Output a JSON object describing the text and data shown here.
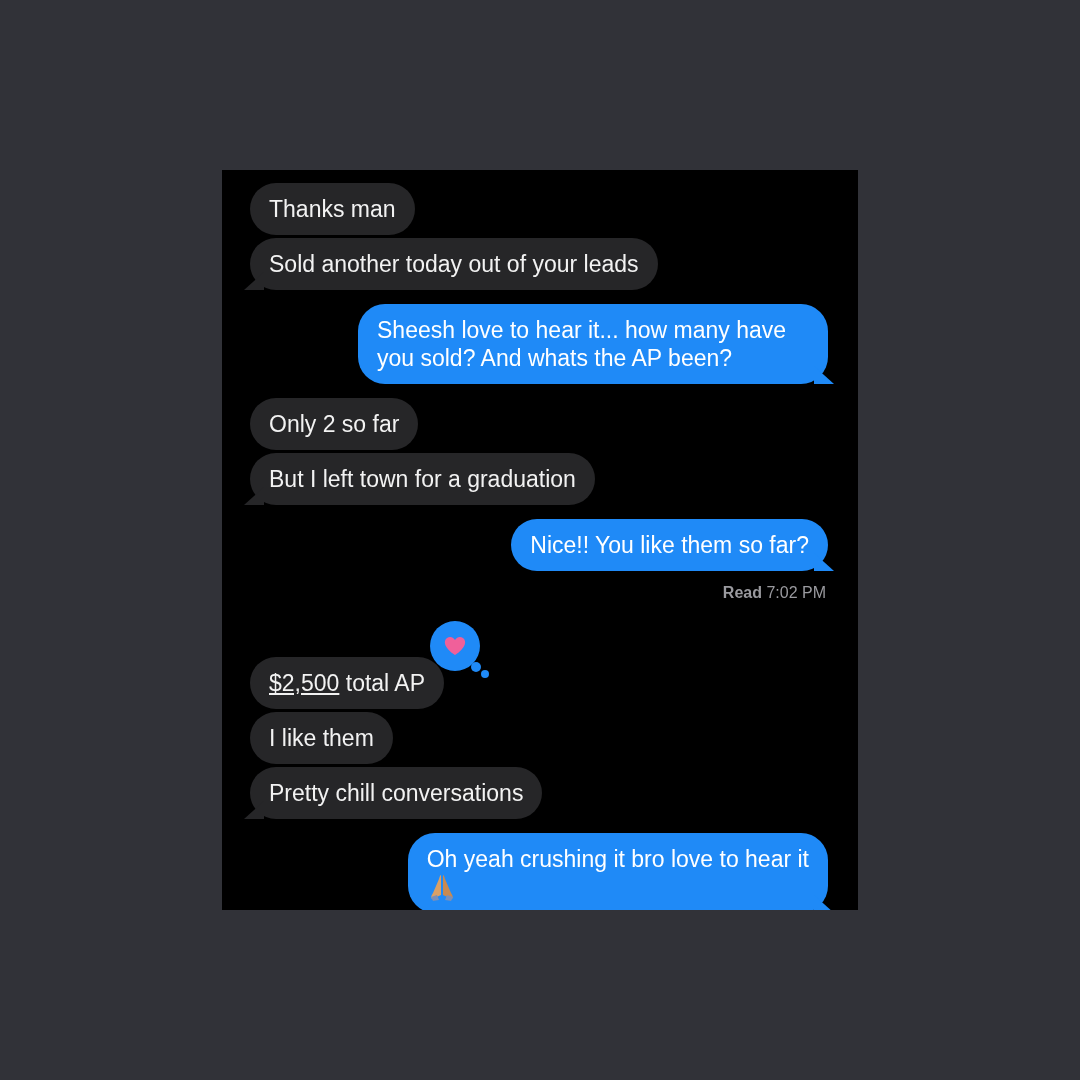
{
  "messages": [
    {
      "kind": "incoming",
      "tail": false,
      "parts": [
        {
          "text": "Thanks man",
          "link": false
        }
      ]
    },
    {
      "kind": "incoming",
      "tail": true,
      "parts": [
        {
          "text": "Sold another today out of your leads",
          "link": false
        }
      ]
    },
    {
      "kind": "outgoing",
      "tail": true,
      "parts": [
        {
          "text": "Sheesh love to hear it... how many have you sold? And whats the AP been?",
          "link": false
        }
      ]
    },
    {
      "kind": "incoming",
      "tail": false,
      "parts": [
        {
          "text": "Only 2 so far",
          "link": false
        }
      ]
    },
    {
      "kind": "incoming",
      "tail": true,
      "parts": [
        {
          "text": "But I left town for a graduation",
          "link": false
        }
      ]
    },
    {
      "kind": "outgoing",
      "tail": true,
      "parts": [
        {
          "text": "Nice!! You like them so far?",
          "link": false
        }
      ],
      "receipt": "**Read** 7:02 PM"
    },
    {
      "kind": "incoming",
      "tail": false,
      "tapback": true,
      "parts": [
        {
          "text": "$2,500",
          "link": true
        },
        {
          "text": "total AP",
          "link": false
        }
      ]
    },
    {
      "kind": "incoming",
      "tail": false,
      "parts": [
        {
          "text": "I like them",
          "link": false
        }
      ]
    },
    {
      "kind": "incoming",
      "tail": true,
      "parts": [
        {
          "text": "Pretty chill conversations",
          "link": false
        }
      ]
    },
    {
      "kind": "outgoing",
      "tail": true,
      "emoji": true,
      "parts": [
        {
          "text": "Oh yeah crushing it bro love to hear it",
          "link": false
        }
      ]
    }
  ]
}
